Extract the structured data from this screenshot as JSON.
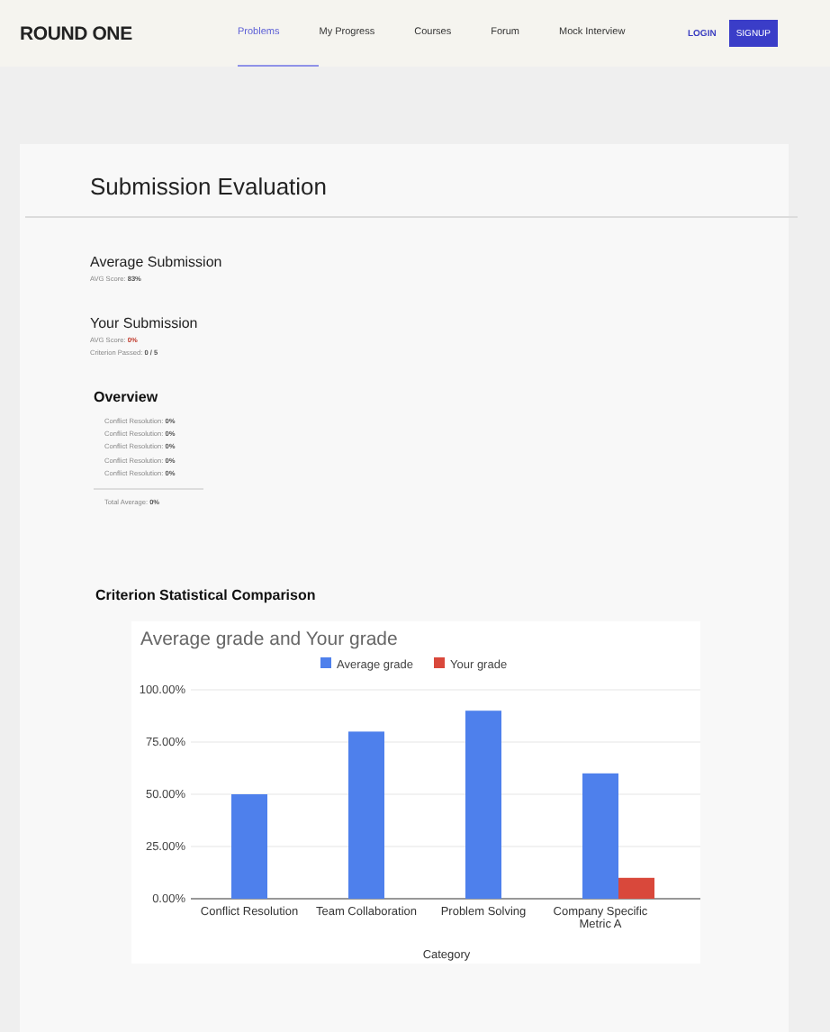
{
  "navbar": {
    "logo": "ROUND ONE",
    "links": [
      {
        "label": "Problems",
        "selected": true
      },
      {
        "label": "My Progress",
        "selected": false
      },
      {
        "label": "Courses",
        "selected": false
      },
      {
        "label": "Forum",
        "selected": false
      },
      {
        "label": "Mock Interview",
        "selected": false
      }
    ],
    "login": "LOGIN",
    "signup": "SIGNUP"
  },
  "page_title": "Submission Evaluation",
  "average_submission": {
    "heading": "Average Submission",
    "lines": [
      {
        "label": "AVG Score:",
        "value": "83%"
      }
    ]
  },
  "your_submission": {
    "heading": "Your Submission",
    "lines": [
      {
        "label": "AVG Score:",
        "value": "0%",
        "alert": true
      },
      {
        "label": "Criterion Passed:",
        "value": "0 / 5",
        "alert": false
      }
    ]
  },
  "overview": {
    "heading": "Overview",
    "items": [
      {
        "label": "Conflict Resolution:",
        "value": "0%"
      },
      {
        "label": "Conflict Resolution:",
        "value": "0%"
      },
      {
        "label": "Conflict Resolution:",
        "value": "0%"
      },
      {
        "label": "Conflict Resolution:",
        "value": "0%"
      },
      {
        "label": "Conflict Resolution:",
        "value": "0%"
      }
    ],
    "total": {
      "label": "Total Average:",
      "value": "0%"
    }
  },
  "comparison": {
    "heading": "Criterion Statistical Comparison",
    "chart_data": {
      "type": "bar",
      "title": "Average grade and Your grade",
      "xlabel": "Category",
      "categories": [
        "Conflict Resolution",
        "Team Collaboration",
        "Problem Solving",
        "Company Specific Metric A"
      ],
      "series": [
        {
          "name": "Average grade",
          "color": "#4e80ec",
          "values": [
            0.5,
            0.8,
            0.9,
            0.6
          ]
        },
        {
          "name": "Your grade",
          "color": "#d9483b",
          "values": [
            0,
            0,
            0,
            0.1
          ]
        }
      ],
      "ylim": [
        0,
        1
      ],
      "grid": true,
      "legend": "top",
      "yticks": [
        {
          "value": 0,
          "label": "0.00%"
        },
        {
          "value": 0.25,
          "label": "25.00%"
        },
        {
          "value": 0.5,
          "label": "50.00%"
        },
        {
          "value": 0.75,
          "label": "75.00%"
        },
        {
          "value": 1,
          "label": "100.00%"
        }
      ]
    }
  }
}
